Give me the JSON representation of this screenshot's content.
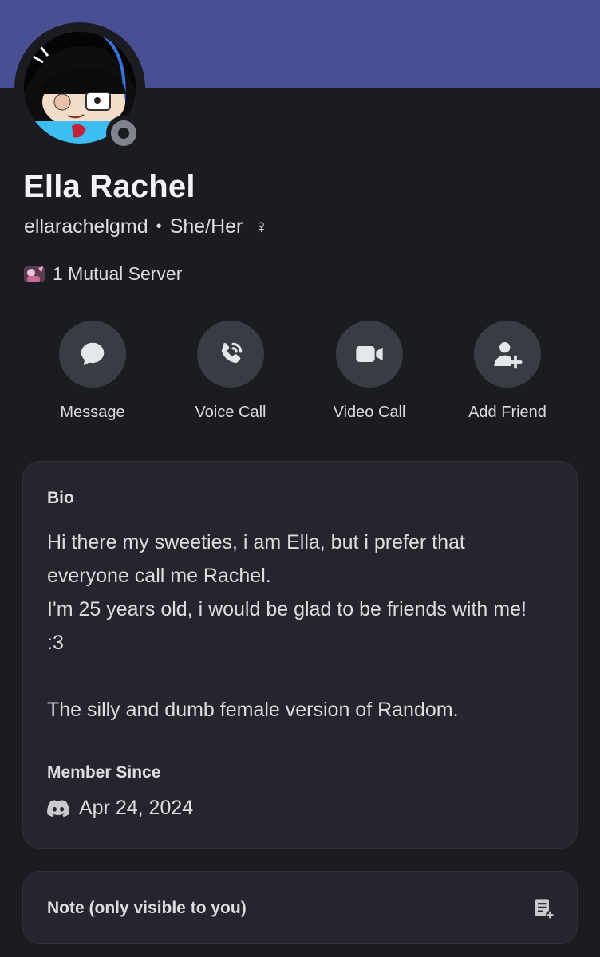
{
  "profile": {
    "display_name": "Ella Rachel",
    "username": "ellarachelgmd",
    "separator": "•",
    "pronouns": "She/Her",
    "gender_symbol": "♀",
    "status": "offline",
    "mutual_servers": "1 Mutual Server"
  },
  "actions": [
    {
      "label": "Message",
      "icon": "message-icon"
    },
    {
      "label": "Voice Call",
      "icon": "phone-icon"
    },
    {
      "label": "Video Call",
      "icon": "video-camera-icon"
    },
    {
      "label": "Add Friend",
      "icon": "add-friend-icon"
    }
  ],
  "bio": {
    "title": "Bio",
    "text": "Hi there my sweeties, i am Ella, but i prefer that everyone call me Rachel.\nI'm 25 years old, i would be glad to be friends with me! :3\n\nThe silly and dumb female version of Random."
  },
  "member_since": {
    "title": "Member Since",
    "date": "Apr 24, 2024",
    "icon": "discord-icon"
  },
  "note": {
    "title": "Note (only visible to you)",
    "icon": "edit-note-icon"
  },
  "colors": {
    "banner": "#494f93",
    "background": "#1b1c21",
    "card": "#25262d",
    "action_button": "#3a3c44",
    "status_offline": "#80848e"
  }
}
